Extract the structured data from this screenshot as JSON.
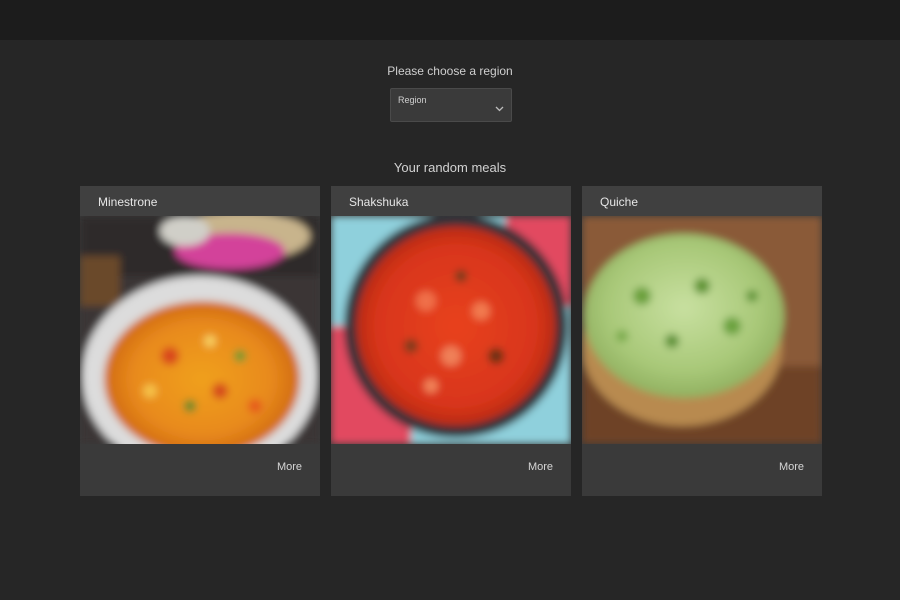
{
  "header": {
    "prompt": "Please choose a region",
    "region_select": {
      "selected": "Region"
    }
  },
  "main": {
    "section_title": "Your random meals",
    "meals": [
      {
        "name": "Minestrone",
        "more_label": "More"
      },
      {
        "name": "Shakshuka",
        "more_label": "More"
      },
      {
        "name": "Quiche",
        "more_label": "More"
      }
    ]
  },
  "colors": {
    "page_background": "#262626",
    "top_bar": "#1c1c1c",
    "card_background": "#3a3a3a",
    "card_header": "#404040"
  },
  "icons": [
    "chevron-down-icon"
  ]
}
